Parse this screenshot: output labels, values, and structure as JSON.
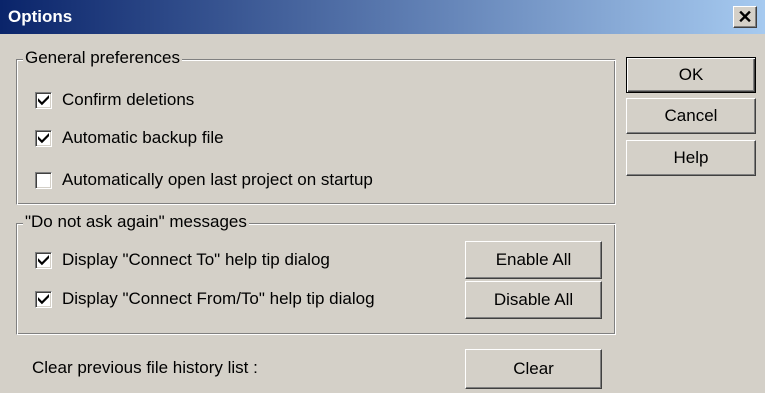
{
  "window": {
    "title": "Options",
    "close_symbol": "✕"
  },
  "general": {
    "legend": "General preferences",
    "options": [
      {
        "label": "Confirm deletions",
        "checked": true
      },
      {
        "label": "Automatic backup file",
        "checked": true
      },
      {
        "label": "Automatically open last project on startup",
        "checked": false
      }
    ]
  },
  "messages": {
    "legend": "\"Do not ask again\" messages",
    "options": [
      {
        "label": "Display \"Connect To\" help tip dialog",
        "checked": true
      },
      {
        "label": "Display \"Connect From/To\" help tip dialog",
        "checked": true
      }
    ],
    "enable_all": "Enable All",
    "disable_all": "Disable All"
  },
  "history": {
    "label": "Clear previous file history list :",
    "clear_button": "Clear"
  },
  "buttons": {
    "ok": "OK",
    "cancel": "Cancel",
    "help": "Help"
  }
}
